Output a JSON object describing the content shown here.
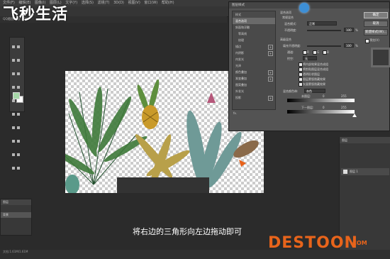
{
  "watermark": "飞秒生活",
  "menubar": [
    "文件(F)",
    "编辑(E)",
    "图像(I)",
    "图层(L)",
    "文字(Y)",
    "选择(S)",
    "滤镜(T)",
    "3D(D)",
    "视图(V)",
    "窗口(W)",
    "帮助(H)"
  ],
  "doc_tab": "QQ截图...@ 50%",
  "dialog": {
    "title": "图层样式",
    "styles_header": "样式",
    "styles": [
      "混合选项",
      "斜面和浮雕",
      "等高线",
      "纹理",
      "描边",
      "内阴影",
      "内发光",
      "光泽",
      "颜色叠加",
      "渐变叠加",
      "图案叠加",
      "外发光",
      "投影"
    ],
    "fx_label": "fx.",
    "section_blend": "混合选项",
    "section_general": "常规混合",
    "blend_mode_label": "混合模式:",
    "blend_mode_value": "正常",
    "opacity_label": "不透明度:",
    "opacity_value": "100",
    "pct": "%",
    "section_advanced": "高级混合",
    "fill_opacity_label": "填充不透明度:",
    "fill_opacity_value": "100",
    "channels_label": "通道:",
    "ch_r": "R",
    "ch_g": "G",
    "ch_b": "B",
    "knockout_label": "挖空:",
    "knockout_value": "无",
    "adv_options": [
      "将内部效果混合成组",
      "将剪贴图层混合成组",
      "透明形状图层",
      "图层蒙版隐藏效果",
      "矢量蒙版隐藏效果"
    ],
    "blend_if_label": "混合颜色带:",
    "blend_if_value": "灰色",
    "this_layer_label": "本图层:",
    "this_layer_values": [
      "0",
      "255"
    ],
    "under_layer_label": "下一图层:",
    "under_layer_values": [
      "0",
      "255"
    ],
    "buttons": [
      "确定",
      "取消",
      "新建样式(W)..."
    ],
    "preview_label": "预览(V)"
  },
  "layers_panel": {
    "tab": "图层",
    "layer_name": "图层 1"
  },
  "layer_panel_left": {
    "title": "图层",
    "item": "背景"
  },
  "status": "文档:1.61M/1.61M",
  "subtitle": "将右边的三角形向左边拖动即可",
  "logo": "DESTOON",
  "logo_domain": ".COM"
}
